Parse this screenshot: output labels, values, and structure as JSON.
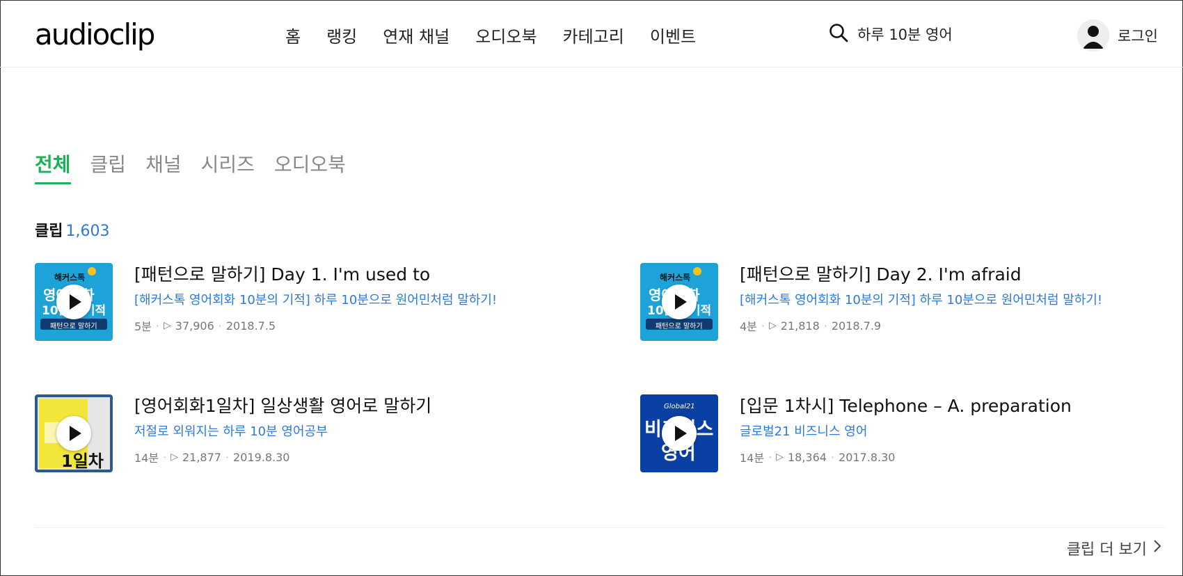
{
  "header": {
    "logo": "audioclip",
    "nav": [
      "홈",
      "랭킹",
      "연재 채널",
      "오디오북",
      "카테고리",
      "이벤트"
    ],
    "search_value": "하루 10분 영어",
    "login_label": "로그인"
  },
  "tabs": [
    "전체",
    "클립",
    "채널",
    "시리즈",
    "오디오북"
  ],
  "section": {
    "label": "클립",
    "count": "1,603"
  },
  "clips": [
    {
      "title": "[패턴으로 말하기] Day 1. I'm used to",
      "channel": "[해커스톡 영어회화 10분의 기적] 하루 10분으로 원어민처럼 말하기!",
      "duration": "5분",
      "plays": "37,906",
      "date": "2018.7.5",
      "thumb_text": [
        "해커스톡",
        "영어회화",
        "10분의 기적",
        "패턴으로 말하기"
      ]
    },
    {
      "title": "[패턴으로 말하기] Day 2. I'm afraid",
      "channel": "[해커스톡 영어회화 10분의 기적] 하루 10분으로 원어민처럼 말하기!",
      "duration": "4분",
      "plays": "21,818",
      "date": "2018.7.9",
      "thumb_text": [
        "해커스톡",
        "영어회화",
        "10분의 기적",
        "패턴으로 말하기"
      ]
    },
    {
      "title": "[영어회화1일차] 일상생활 영어로 말하기",
      "channel": "저절로 외워지는 하루 10분 영어공부",
      "duration": "14분",
      "plays": "21,877",
      "date": "2019.8.30",
      "thumb_text": [
        "1일차"
      ]
    },
    {
      "title": "[입문 1차시] Telephone – A. preparation",
      "channel": "글로벌21 비즈니스 영어",
      "duration": "14분",
      "plays": "18,364",
      "date": "2017.8.30",
      "thumb_text": [
        "Global21",
        "비즈니스",
        "영어"
      ]
    }
  ],
  "more_label": "클립 더 보기",
  "colors": {
    "accent": "#18b356",
    "link": "#2a7ae2"
  }
}
